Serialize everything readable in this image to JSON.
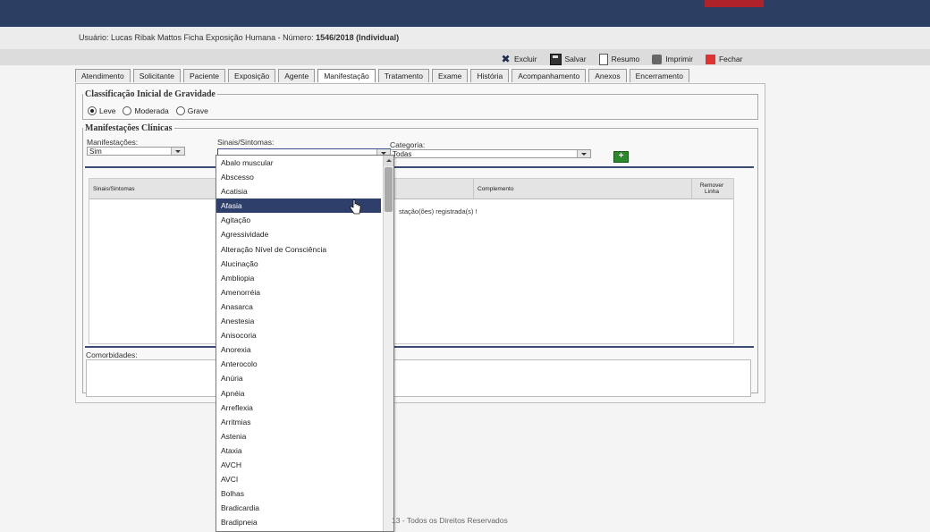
{
  "header": {
    "user_line": "Usuário: Lucas Ribak Mattos Ficha Exposição Humana - Número:",
    "record": "1546/2018 (Individual)"
  },
  "toolbar": {
    "excluir": "Excluir",
    "salvar": "Salvar",
    "resumo": "Resumo",
    "imprimir": "Imprimir",
    "fechar": "Fechar"
  },
  "tabs": [
    "Atendimento",
    "Solicitante",
    "Paciente",
    "Exposição",
    "Agente",
    "Manifestação",
    "Tratamento",
    "Exame",
    "História",
    "Acompanhamento",
    "Anexos",
    "Encerramento"
  ],
  "active_tab": "Manifestação",
  "gravidade": {
    "legend": "Classificação Inicial de Gravidade",
    "options": [
      "Leve",
      "Moderada",
      "Grave"
    ],
    "selected": "Leve"
  },
  "manifestacoes": {
    "legend": "Manifestações Clínicas",
    "manif_label": "Manifestações:",
    "manif_value": "Sim",
    "sinais_label": "Sinais/Sintomas:",
    "sinais_value": "",
    "categoria_label": "Categoria:",
    "categoria_value": "Todas"
  },
  "table": {
    "headers": {
      "sinais": "Sinais/Sintomas",
      "complemento": "Complemento",
      "remover": "Remover Linha"
    },
    "message": "stação(ões) registrada(s) !"
  },
  "comorbidades": {
    "label": "Comorbidades:"
  },
  "dropdown": {
    "items": [
      "Abalo muscular",
      "Abscesso",
      "Acatisia",
      "Afasia",
      "Agitação",
      "Agressividade",
      "Alteração Nível de Consciência",
      "Alucinação",
      "Ambliopia",
      "Amenorréia",
      "Anasarca",
      "Anestesia",
      "Anisocoria",
      "Anorexia",
      "Anterocolo",
      "Anúria",
      "Apnéia",
      "Arreflexia",
      "Arritmias",
      "Astenia",
      "Ataxia",
      "AVCH",
      "AVCI",
      "Bolhas",
      "Bradicardia",
      "Bradipneia"
    ],
    "selected": "Afasia"
  },
  "footer": {
    "text": "13 - Todos os Direitos Reservados"
  }
}
